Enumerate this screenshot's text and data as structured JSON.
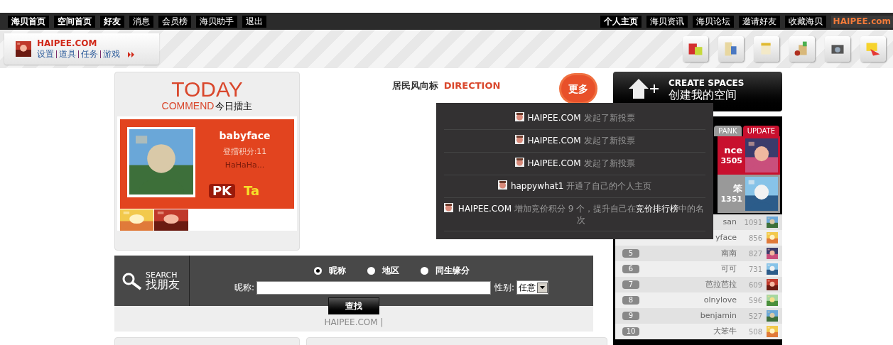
{
  "top_nav": {
    "left": [
      {
        "label": "海贝首页",
        "bold": true
      },
      {
        "label": "空间首页",
        "bold": true
      },
      {
        "label": "好友",
        "bold": true
      },
      {
        "label": "消息",
        "bold": false
      },
      {
        "label": "会员榜",
        "bold": false
      },
      {
        "label": "海贝助手",
        "bold": false
      },
      {
        "label": "退出",
        "bold": false
      }
    ],
    "right": [
      {
        "label": "个人主页",
        "bold": true
      },
      {
        "label": "海贝资讯",
        "bold": false
      },
      {
        "label": "海贝论坛",
        "bold": false
      },
      {
        "label": "邀请好友",
        "bold": false
      },
      {
        "label": "收藏海贝",
        "bold": false
      }
    ],
    "logo": "HAIPEE.com"
  },
  "user_bar": {
    "site": "HAIPEE.COM",
    "links": [
      "设置",
      "道具",
      "任务",
      "游戏"
    ]
  },
  "today": {
    "title": "TODAY",
    "subtitle": "COMMEND",
    "subtitle_cn": "今日擂主",
    "name": "babyface",
    "score": "登擂积分:11",
    "motto": "HaHaHa...",
    "pk": "PK",
    "ta": "Ta"
  },
  "direction": {
    "title": "居民风向标",
    "title_en": "DIRECTION",
    "more": "更多",
    "feed": [
      {
        "user": "HAIPEE.COM",
        "action": "发起了新投票"
      },
      {
        "user": "HAIPEE.COM",
        "action": "发起了新投票"
      },
      {
        "user": "HAIPEE.COM",
        "action": "发起了新投票"
      },
      {
        "user": "happywhat1",
        "action": "开通了自己的个人主页"
      },
      {
        "user": "HAIPEE.COM",
        "action": "增加竞价积分 9 个，提升自己在",
        "link": "竞价排行榜",
        "action_end": "中的名次"
      }
    ]
  },
  "search": {
    "title_en": "SEARCH",
    "title": "找朋友",
    "options": [
      {
        "label": "昵称",
        "selected": true
      },
      {
        "label": "地区",
        "selected": false
      },
      {
        "label": "同生缘分",
        "selected": false
      }
    ],
    "field_label": "昵称:",
    "gender_label": "性别:",
    "gender_value": "任意",
    "button": "查找",
    "footer": "HAIPEE.COM |"
  },
  "create_spaces": {
    "title_en": "CREATE SPACES",
    "title": "创建我的空间"
  },
  "rank": {
    "tabs": [
      {
        "label": "PANK",
        "selected": false
      },
      {
        "label": "UPDATE",
        "selected": true
      }
    ],
    "featured": [
      {
        "name": "nce",
        "score": "3505",
        "highlight": true
      },
      {
        "name": "笨",
        "score": "1351",
        "highlight": false
      }
    ],
    "rows": [
      {
        "rank": "",
        "name": "san",
        "score": "1091"
      },
      {
        "rank": "",
        "name": "yface",
        "score": "856"
      },
      {
        "rank": "5",
        "name": "南南",
        "score": "827"
      },
      {
        "rank": "6",
        "name": "可可",
        "score": "731"
      },
      {
        "rank": "7",
        "name": "芭拉芭拉",
        "score": "609"
      },
      {
        "rank": "8",
        "name": "olnylove",
        "score": "596"
      },
      {
        "rank": "9",
        "name": "benjamin",
        "score": "527"
      },
      {
        "rank": "10",
        "name": "大笨牛",
        "score": "508"
      }
    ]
  }
}
